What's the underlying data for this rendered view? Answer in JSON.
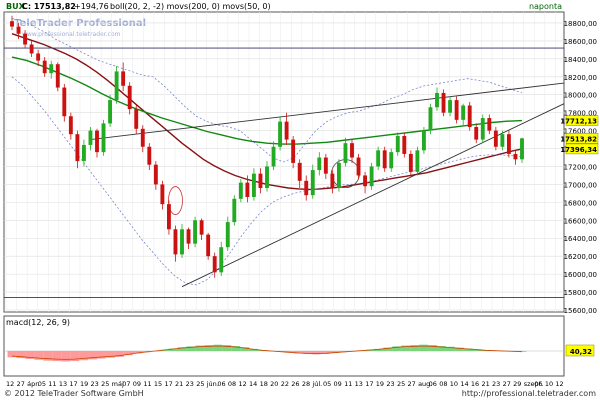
{
  "header": {
    "instrument": "BUX",
    "quote": "C: 17513,82",
    "change": "+194,76",
    "indicators": "boll(20, 2, -2) movs(200, 0) movs(50, 0)",
    "period": "naponta"
  },
  "macd_label": "macd(12, 26, 9)",
  "watermark": {
    "line1": "TeleTrader Professional",
    "line2": "www.professional.teletrader.com"
  },
  "footer": {
    "copyright": "© 2012 TeleTrader Software GmbH",
    "url": "http://professional.teletrader.com"
  },
  "colors": {
    "up_candle": "#22aa22",
    "down_candle": "#cc1111",
    "ma50": "#118811",
    "ma200": "#881111",
    "bollinger": "#6677cc",
    "trendline": "#333333",
    "macd_up": "#66cc66",
    "macd_down": "#ff8888",
    "price_label_bg": "#ffff00",
    "macd_label_bg": "#ffff00"
  },
  "chart_data": [
    {
      "type": "candlestick",
      "title": "",
      "ylim": [
        15600,
        18900
      ],
      "y_ticks": [
        "18800,00",
        "18600,00",
        "18400,00",
        "18200,00",
        "18000,00",
        "17800,00",
        "17600,00",
        "17400,00",
        "17200,00",
        "17000,00",
        "16800,00",
        "16600,00",
        "16400,00",
        "16200,00",
        "16000,00",
        "15800,00",
        "15600,00"
      ],
      "price_tags": [
        {
          "text": "17712,13",
          "value": 17712
        },
        {
          "text": "17513,82",
          "value": 17514
        },
        {
          "text": "17396,34",
          "value": 17396
        }
      ],
      "x_ticks": [
        "12",
        "27",
        "ápr.",
        "05",
        "11",
        "13",
        "17",
        "19",
        "23",
        "25",
        "máj",
        "07",
        "09",
        "11",
        "15",
        "17",
        "21",
        "23",
        "25",
        "jún.",
        "06",
        "08",
        "12",
        "14",
        "18",
        "20",
        "22",
        "26",
        "28",
        "júl.",
        "05",
        "09",
        "11",
        "13",
        "17",
        "19",
        "23",
        "25",
        "27",
        "aug.",
        "06",
        "08",
        "10",
        "14",
        "16",
        "21",
        "23",
        "27",
        "29",
        "szept.",
        "06",
        "10",
        "12"
      ],
      "candles": [
        [
          18820,
          18880,
          18720,
          18760
        ],
        [
          18760,
          18800,
          18620,
          18680
        ],
        [
          18680,
          18720,
          18520,
          18560
        ],
        [
          18560,
          18600,
          18420,
          18460
        ],
        [
          18460,
          18500,
          18320,
          18380
        ],
        [
          18380,
          18420,
          18200,
          18240
        ],
        [
          18240,
          18380,
          18180,
          18340
        ],
        [
          18340,
          18360,
          18040,
          18080
        ],
        [
          18080,
          18120,
          17700,
          17760
        ],
        [
          17760,
          17800,
          17500,
          17560
        ],
        [
          17560,
          17600,
          17180,
          17260
        ],
        [
          17260,
          17500,
          17200,
          17440
        ],
        [
          17440,
          17640,
          17380,
          17600
        ],
        [
          17600,
          17620,
          17300,
          17360
        ],
        [
          17360,
          17720,
          17320,
          17680
        ],
        [
          17680,
          18000,
          17640,
          17940
        ],
        [
          17940,
          18320,
          17900,
          18260
        ],
        [
          18260,
          18360,
          18040,
          18100
        ],
        [
          18100,
          18140,
          17780,
          17840
        ],
        [
          17840,
          17880,
          17560,
          17620
        ],
        [
          17620,
          17660,
          17360,
          17420
        ],
        [
          17420,
          17460,
          17160,
          17220
        ],
        [
          17220,
          17260,
          16940,
          17000
        ],
        [
          17000,
          17040,
          16720,
          16780
        ],
        [
          16780,
          16820,
          16440,
          16500
        ],
        [
          16500,
          16540,
          16140,
          16220
        ],
        [
          16220,
          16560,
          16180,
          16500
        ],
        [
          16500,
          16520,
          16280,
          16340
        ],
        [
          16340,
          16640,
          16300,
          16600
        ],
        [
          16600,
          16620,
          16380,
          16440
        ],
        [
          16440,
          16460,
          16160,
          16200
        ],
        [
          16200,
          16240,
          15960,
          16020
        ],
        [
          16020,
          16360,
          15980,
          16300
        ],
        [
          16300,
          16640,
          16260,
          16580
        ],
        [
          16580,
          16880,
          16540,
          16840
        ],
        [
          16840,
          17060,
          16800,
          17020
        ],
        [
          17020,
          17100,
          16800,
          16860
        ],
        [
          16860,
          17180,
          16820,
          17120
        ],
        [
          17120,
          17180,
          16900,
          16960
        ],
        [
          16960,
          17260,
          16920,
          17200
        ],
        [
          17200,
          17480,
          17160,
          17420
        ],
        [
          17420,
          17760,
          17380,
          17700
        ],
        [
          17700,
          17800,
          17440,
          17500
        ],
        [
          17500,
          17540,
          17180,
          17240
        ],
        [
          17240,
          17280,
          16960,
          17040
        ],
        [
          17040,
          17100,
          16820,
          16880
        ],
        [
          16880,
          17220,
          16840,
          17160
        ],
        [
          17160,
          17360,
          17100,
          17300
        ],
        [
          17300,
          17340,
          17060,
          17120
        ],
        [
          17120,
          17160,
          16900,
          16960
        ],
        [
          16960,
          17280,
          16920,
          17240
        ],
        [
          17240,
          17520,
          17200,
          17460
        ],
        [
          17460,
          17500,
          17240,
          17300
        ],
        [
          17300,
          17340,
          17060,
          17100
        ],
        [
          17100,
          17140,
          16900,
          16980
        ],
        [
          16980,
          17240,
          16940,
          17200
        ],
        [
          17200,
          17420,
          17160,
          17380
        ],
        [
          17380,
          17420,
          17140,
          17180
        ],
        [
          17180,
          17400,
          17140,
          17360
        ],
        [
          17360,
          17580,
          17320,
          17540
        ],
        [
          17540,
          17580,
          17300,
          17340
        ],
        [
          17340,
          17380,
          17080,
          17140
        ],
        [
          17140,
          17420,
          17100,
          17380
        ],
        [
          17380,
          17640,
          17340,
          17600
        ],
        [
          17600,
          17900,
          17560,
          17860
        ],
        [
          17860,
          18080,
          17820,
          18020
        ],
        [
          18020,
          18060,
          17760,
          17800
        ],
        [
          17800,
          17980,
          17760,
          17940
        ],
        [
          17940,
          17980,
          17680,
          17720
        ],
        [
          17720,
          17900,
          17660,
          17880
        ],
        [
          17880,
          17920,
          17600,
          17640
        ],
        [
          17640,
          17680,
          17460,
          17500
        ],
        [
          17500,
          17780,
          17460,
          17740
        ],
        [
          17740,
          17780,
          17560,
          17600
        ],
        [
          17600,
          17640,
          17380,
          17420
        ],
        [
          17420,
          17600,
          17380,
          17560
        ],
        [
          17560,
          17600,
          17300,
          17340
        ],
        [
          17340,
          17380,
          17220,
          17280
        ],
        [
          17280,
          17520,
          17240,
          17514
        ]
      ],
      "overlays": [
        {
          "name": "",
          "kind": "ma200",
          "values": [
            18680,
            18640,
            18600,
            18560,
            18510,
            18460,
            18400,
            18330,
            18250,
            18160,
            18060,
            17960,
            17860,
            17760,
            17660,
            17560,
            17460,
            17370,
            17280,
            17210,
            17150,
            17100,
            17060,
            17030,
            17000,
            16980,
            16960,
            16950,
            16945,
            16950,
            16960,
            16970,
            16990,
            17010,
            17030,
            17050,
            17070,
            17090,
            17110,
            17130,
            17160,
            17190,
            17220,
            17250,
            17280,
            17310,
            17340,
            17370,
            17396
          ]
        },
        {
          "name": "",
          "kind": "ma50",
          "values": [
            18420,
            18380,
            18320,
            18250,
            18180,
            18100,
            18010,
            17930,
            17860,
            17800,
            17740,
            17690,
            17640,
            17590,
            17550,
            17510,
            17480,
            17460,
            17450,
            17450,
            17460,
            17470,
            17490,
            17510,
            17530,
            17550,
            17570,
            17590,
            17610,
            17630,
            17650,
            17670,
            17690,
            17705,
            17712
          ]
        },
        {
          "name": "",
          "kind": "bollinger_upper",
          "values": [
            18850,
            18820,
            18760,
            18700,
            18620,
            18560,
            18500,
            18440,
            18380,
            18340,
            18300,
            18260,
            18220,
            18200,
            18100,
            17980,
            17860,
            17760,
            17700,
            17660,
            17640,
            17600,
            17500,
            17400,
            17300,
            17250,
            17300,
            17450,
            17600,
            17700,
            17760,
            17800,
            17820,
            17860,
            17900,
            17960,
            18000,
            18060,
            18100,
            18120,
            18140,
            18160,
            18180,
            18160,
            18140,
            18100,
            18060,
            18020
          ]
        },
        {
          "name": "",
          "kind": "bollinger_lower",
          "values": [
            18200,
            18100,
            17960,
            17820,
            17660,
            17500,
            17340,
            17180,
            17020,
            16860,
            16700,
            16540,
            16380,
            16240,
            16100,
            15980,
            15900,
            15880,
            15940,
            16060,
            16220,
            16400,
            16560,
            16700,
            16800,
            16860,
            16900,
            16930,
            16950,
            16970,
            16990,
            17000,
            17010,
            17030,
            17060,
            17090,
            17120,
            17150,
            17180,
            17210,
            17240,
            17270,
            17300,
            17320,
            17330,
            17330,
            17320,
            17310
          ]
        },
        {
          "name": "",
          "kind": "horizontal",
          "values": [
            18520
          ]
        },
        {
          "name": "",
          "kind": "horizontal",
          "values": [
            15740
          ]
        },
        {
          "name": "",
          "kind": "trendline_upper",
          "values": [
            17500,
            18130
          ]
        },
        {
          "name": "",
          "kind": "trendline_lower",
          "values": [
            15860,
            17900
          ]
        },
        {
          "name": "",
          "kind": "annotation_circle",
          "values": [
            16820,
            17120
          ]
        }
      ]
    },
    {
      "type": "histogram",
      "title": "macd(12, 26, 9)",
      "ylim": [
        -100,
        100
      ],
      "y_ticks": [
        "40,32"
      ],
      "values": [
        -30,
        -34,
        -38,
        -42,
        -46,
        -48,
        -50,
        -48,
        -44,
        -40,
        -36,
        -32,
        -28,
        -20,
        -12,
        -6,
        0,
        6,
        12,
        18,
        22,
        26,
        28,
        30,
        28,
        24,
        18,
        10,
        4,
        0,
        -4,
        -8,
        -12,
        -14,
        -16,
        -14,
        -10,
        -6,
        -2,
        2,
        6,
        10,
        16,
        22,
        26,
        28,
        30,
        28,
        24,
        20,
        16,
        12,
        8,
        4,
        2,
        0,
        -2,
        -4
      ],
      "current_label": "40,32"
    }
  ]
}
